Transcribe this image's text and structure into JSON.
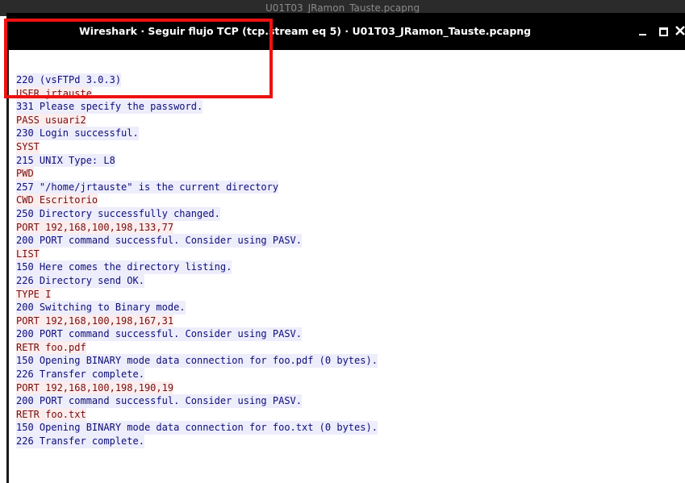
{
  "background_window": {
    "title": "U01T03_JRamon_Tauste.pcapng"
  },
  "window": {
    "title": "Wireshark · Seguir flujo TCP (tcp.stream eq 5) · U01T03_JRamon_Tauste.pcapng",
    "controls": {
      "minimize": "minimize",
      "maximize": "maximize",
      "close": "close"
    }
  },
  "colors": {
    "client_text": "#7a0c0c",
    "client_background": "#fbeded",
    "server_text": "#0d0d7a",
    "server_background": "#ededfb",
    "highlight_border": "#ee1111"
  },
  "stream": {
    "lines": [
      {
        "text": "220 (vsFTPd 3.0.3)",
        "side": "server"
      },
      {
        "text": "USER jrtauste",
        "side": "client"
      },
      {
        "text": "331 Please specify the password.",
        "side": "server"
      },
      {
        "text": "PASS usuari2",
        "side": "client"
      },
      {
        "text": "230 Login successful.",
        "side": "server"
      },
      {
        "text": "SYST",
        "side": "client"
      },
      {
        "text": "215 UNIX Type: L8",
        "side": "server"
      },
      {
        "text": "PWD",
        "side": "client"
      },
      {
        "text": "257 \"/home/jrtauste\" is the current directory",
        "side": "server"
      },
      {
        "text": "CWD Escritorio",
        "side": "client"
      },
      {
        "text": "250 Directory successfully changed.",
        "side": "server"
      },
      {
        "text": "PORT 192,168,100,198,133,77",
        "side": "client"
      },
      {
        "text": "200 PORT command successful. Consider using PASV.",
        "side": "server"
      },
      {
        "text": "LIST",
        "side": "client"
      },
      {
        "text": "150 Here comes the directory listing.",
        "side": "server"
      },
      {
        "text": "226 Directory send OK.",
        "side": "server"
      },
      {
        "text": "TYPE I",
        "side": "client"
      },
      {
        "text": "200 Switching to Binary mode.",
        "side": "server"
      },
      {
        "text": "PORT 192,168,100,198,167,31",
        "side": "client"
      },
      {
        "text": "200 PORT command successful. Consider using PASV.",
        "side": "server"
      },
      {
        "text": "RETR foo.pdf",
        "side": "client"
      },
      {
        "text": "150 Opening BINARY mode data connection for foo.pdf (0 bytes).",
        "side": "server"
      },
      {
        "text": "226 Transfer complete.",
        "side": "server"
      },
      {
        "text": "PORT 192,168,100,198,190,19",
        "side": "client"
      },
      {
        "text": "200 PORT command successful. Consider using PASV.",
        "side": "server"
      },
      {
        "text": "RETR foo.txt",
        "side": "client"
      },
      {
        "text": "150 Opening BINARY mode data connection for foo.txt (0 bytes).",
        "side": "server"
      },
      {
        "text": "226 Transfer complete.",
        "side": "server"
      }
    ]
  }
}
